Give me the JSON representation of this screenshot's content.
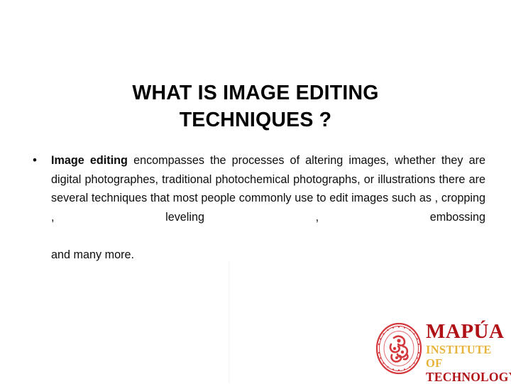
{
  "slide": {
    "background_color": "#ffffff",
    "title": {
      "line1": "WHAT IS IMAGE EDITING",
      "line2": "TECHNIQUES ?",
      "color": "#000000"
    },
    "body": {
      "bullet_marker": "•",
      "lead_bold": "Image editing",
      "line1_rest": " encompasses the processes of altering images, whether",
      "line2": "they are digital photographes, traditional photochemical photographs,",
      "line3": "or illustrations there are several techniques that most people",
      "line4": "commonly use to edit images such as , cropping , leveling , embossing",
      "line5": "and many more.",
      "full_text": "Image editing encompasses the processes of altering images, whether they are digital photographes, traditional photochemical photographs, or illustrations there are several techniques that most people commonly use to edit images such as , cropping , leveling , embossing and many more.",
      "color": "#0d0d0d"
    },
    "logo": {
      "seal_name": "mapua-seal-icon",
      "seal_color": "#d4373c",
      "wordmark_line1": "MAPÚA",
      "wordmark_line2": "INSTITUTE OF",
      "wordmark_line3": "TECHNOLOGY",
      "wordmark_line1_color": "#b01116",
      "wordmark_line2_color": "#e8b33a",
      "wordmark_line3_color": "#b01116"
    }
  }
}
